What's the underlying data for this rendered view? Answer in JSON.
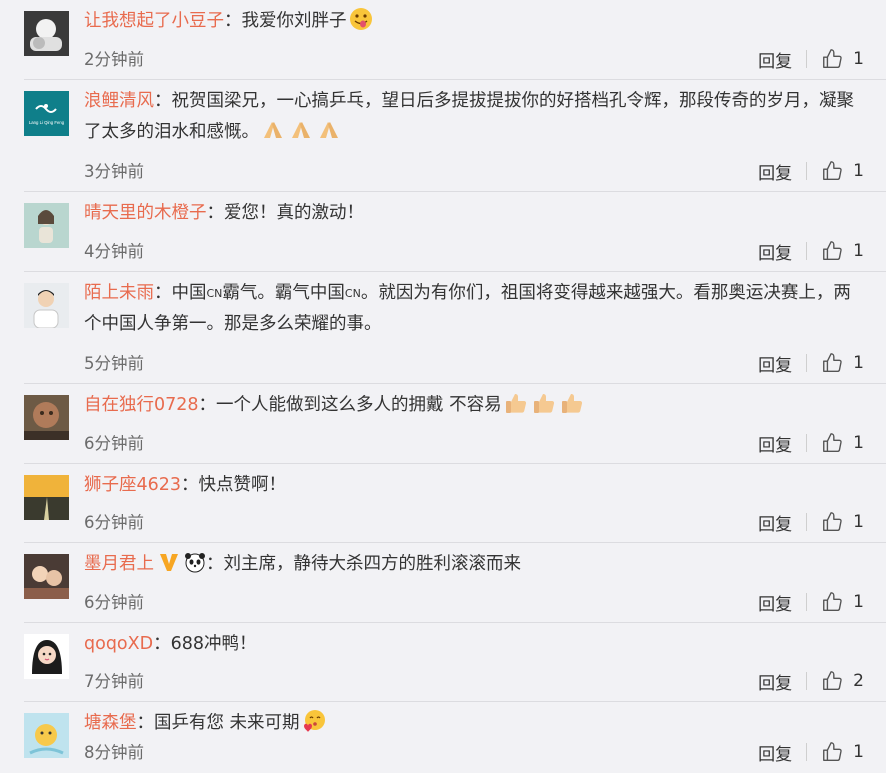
{
  "reply_label": "回复",
  "colors": {
    "username": "#e86b4e",
    "background": "#f2f2f5",
    "text": "#333333",
    "meta": "#6b6b6b"
  },
  "comments": [
    {
      "user": "让我想起了小豆子",
      "sep": "：",
      "text": "我爱你刘胖子",
      "time": "2分钟前",
      "likes": "1",
      "emoji": "tongue-face"
    },
    {
      "user": "浪鲤清风",
      "sep": "：",
      "text": "祝贺国梁兄，一心搞乒乓，望日后多提拔提拔你的好搭档孔令辉，那段传奇的岁月，凝聚了太多的泪水和感慨。",
      "time": "3分钟前",
      "likes": "1",
      "avatar_text": "Lang Li Qing Feng",
      "emoji": "pray-hands"
    },
    {
      "user": "晴天里的木橙子",
      "sep": "：",
      "text": "爱您！真的激动！",
      "time": "4分钟前",
      "likes": "1"
    },
    {
      "user": "陌上未雨",
      "sep": "：",
      "text_a": "中国",
      "cn": "CN",
      "text_b": "霸气。霸气中国",
      "text_c": "。就因为有你们，祖国将变得越来越强大。看那奥运决赛上，两个中国人争第一。那是多么荣耀的事。",
      "time": "5分钟前",
      "likes": "1"
    },
    {
      "user": "自在独行0728",
      "sep": "：",
      "text": "一个人能做到这么多人的拥戴 不容易",
      "time": "6分钟前",
      "likes": "1",
      "emoji": "thumbs-up"
    },
    {
      "user": "狮子座4623",
      "sep": "：",
      "text": "快点赞啊！",
      "time": "6分钟前",
      "likes": "1"
    },
    {
      "user": "墨月君上",
      "sep": "：",
      "text": "刘主席，静待大杀四方的胜利滚滚而来",
      "time": "6分钟前",
      "likes": "1",
      "badges": [
        "vip-v-badge",
        "panda-badge"
      ]
    },
    {
      "user": "qoqoXD",
      "sep": "：",
      "text": "688冲鸭！",
      "time": "7分钟前",
      "likes": "2"
    },
    {
      "user": "塘森堡",
      "sep": "：",
      "text": "国乒有您 未来可期",
      "time": "8分钟前",
      "likes": "1",
      "emoji": "love-face"
    }
  ]
}
